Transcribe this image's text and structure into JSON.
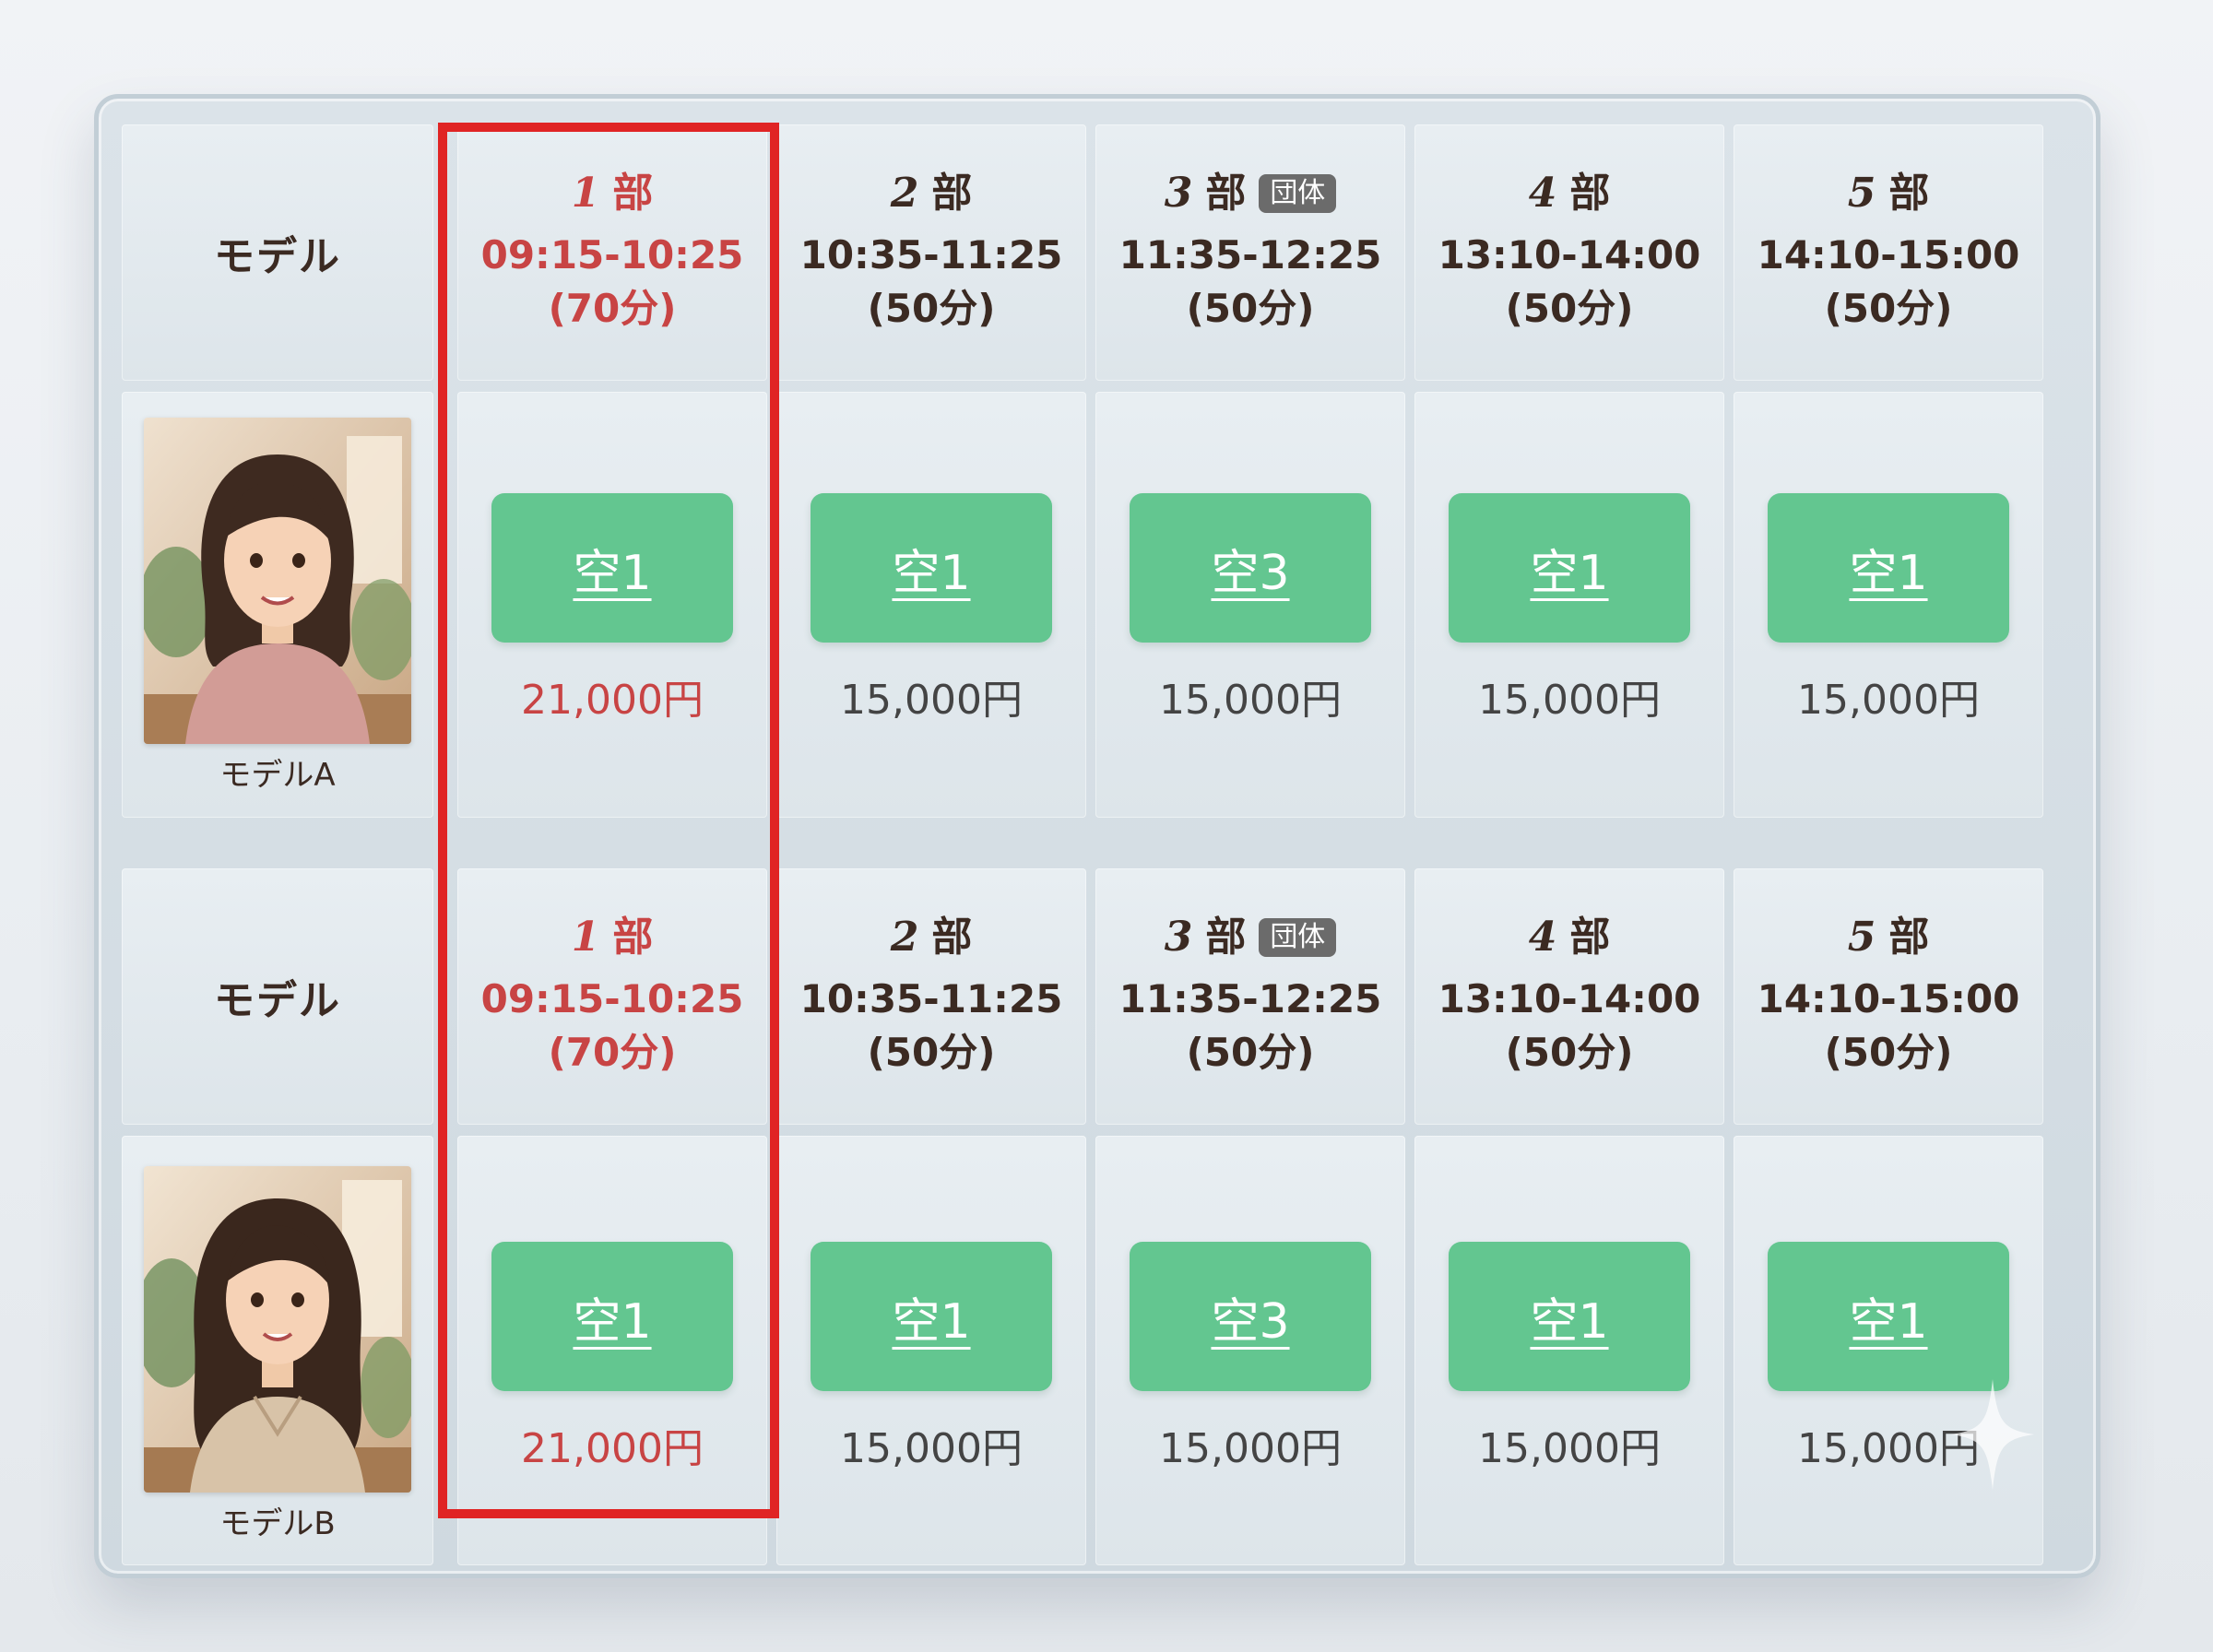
{
  "header_label": "モデル",
  "parts": [
    {
      "part": "1",
      "kanji": "部",
      "badge": "",
      "time": "09:15-10:25",
      "duration": "(70分)"
    },
    {
      "part": "2",
      "kanji": "部",
      "badge": "",
      "time": "10:35-11:25",
      "duration": "(50分)"
    },
    {
      "part": "3",
      "kanji": "部",
      "badge": "団体",
      "time": "11:35-12:25",
      "duration": "(50分)"
    },
    {
      "part": "4",
      "kanji": "部",
      "badge": "",
      "time": "13:10-14:00",
      "duration": "(50分)"
    },
    {
      "part": "5",
      "kanji": "部",
      "badge": "",
      "time": "14:10-15:00",
      "duration": "(50分)"
    }
  ],
  "models": [
    {
      "name": "モデルA",
      "slots": [
        {
          "availability": "空1",
          "price": "21,000円"
        },
        {
          "availability": "空1",
          "price": "15,000円"
        },
        {
          "availability": "空3",
          "price": "15,000円"
        },
        {
          "availability": "空1",
          "price": "15,000円"
        },
        {
          "availability": "空1",
          "price": "15,000円"
        }
      ]
    },
    {
      "name": "モデルB",
      "slots": [
        {
          "availability": "空1",
          "price": "21,000円"
        },
        {
          "availability": "空1",
          "price": "15,000円"
        },
        {
          "availability": "空3",
          "price": "15,000円"
        },
        {
          "availability": "空1",
          "price": "15,000円"
        },
        {
          "availability": "空1",
          "price": "15,000円"
        }
      ]
    }
  ],
  "colors": {
    "available_button": "#63c690",
    "highlight_border": "#e02424",
    "highlight_text": "#c84444",
    "badge_bg": "#6b6b6b"
  },
  "icons": [
    "model-a-portrait",
    "model-b-portrait",
    "sparkle-icon"
  ]
}
